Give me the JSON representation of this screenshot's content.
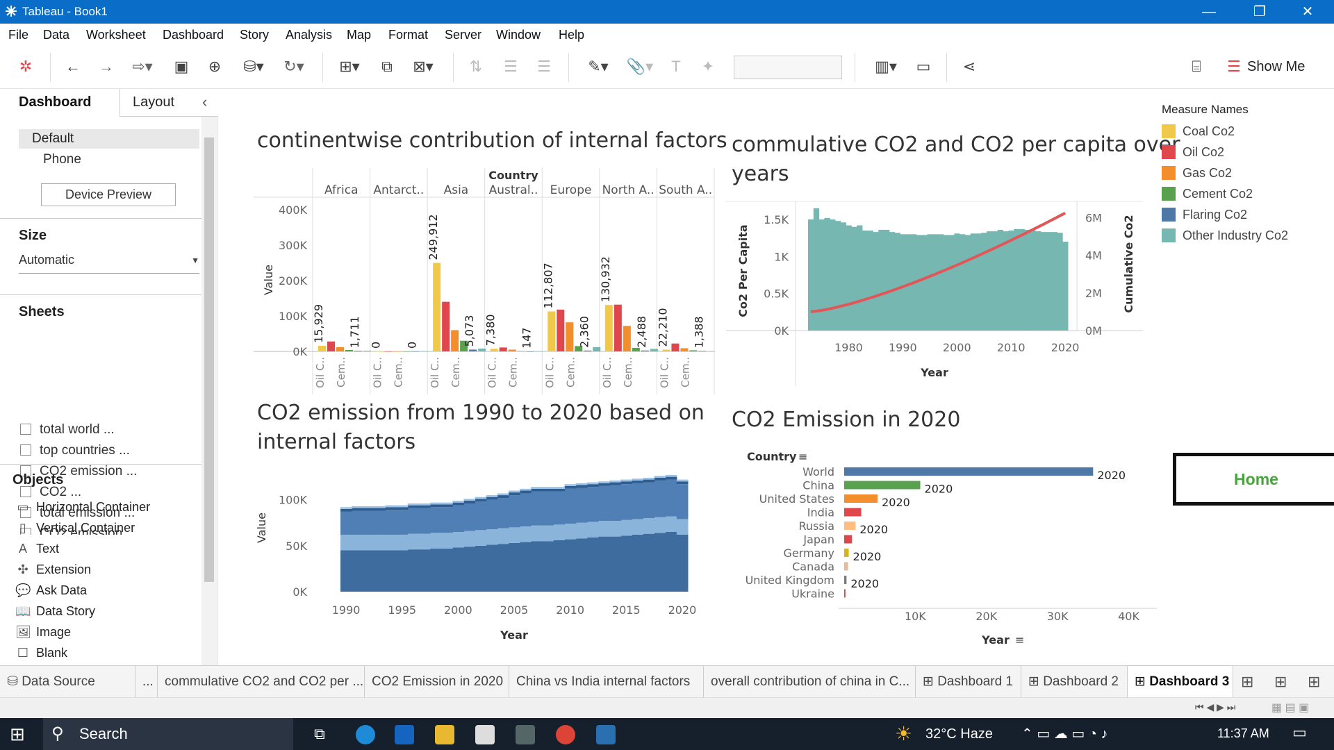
{
  "window": {
    "title": "Tableau - Book1",
    "controls": [
      "—",
      "❐",
      "✕"
    ]
  },
  "menu": [
    "File",
    "Data",
    "Worksheet",
    "Dashboard",
    "Story",
    "Analysis",
    "Map",
    "Format",
    "Server",
    "Window",
    "Help"
  ],
  "toolbar": {
    "show_me": "Show Me"
  },
  "leftpane": {
    "tabs": {
      "dashboard": "Dashboard",
      "layout": "Layout"
    },
    "devices": [
      "Default",
      "Phone"
    ],
    "device_preview": "Device Preview",
    "size_title": "Size",
    "size_value": "Automatic",
    "sheets_title": "Sheets",
    "sheets": [
      "total world ...",
      "top countries ...",
      "CO2 emission ...",
      "CO2 ...",
      "total emission ...",
      "CO2 emission"
    ],
    "objects_title": "Objects",
    "objects": [
      {
        "icon": "horizontal-container-icon",
        "glyph": "▭",
        "label": "Horizontal Container"
      },
      {
        "icon": "vertical-container-icon",
        "glyph": "▯",
        "label": "Vertical Container"
      },
      {
        "icon": "text-icon",
        "glyph": "A",
        "label": "Text"
      },
      {
        "icon": "extension-icon",
        "glyph": "✣",
        "label": "Extension"
      },
      {
        "icon": "ask-data-icon",
        "glyph": "💬",
        "label": "Ask Data"
      },
      {
        "icon": "data-story-icon",
        "glyph": "📖",
        "label": "Data Story"
      },
      {
        "icon": "image-icon",
        "glyph": "🖼",
        "label": "Image"
      },
      {
        "icon": "blank-icon",
        "glyph": "☐",
        "label": "Blank"
      }
    ]
  },
  "titles": {
    "chart1": "continentwise contribution of internal factors",
    "chart2a": "commulative CO2 and CO2 per capita over",
    "chart2b": "years",
    "chart3a": "CO2 emission from 1990 to 2020 based on",
    "chart3b": "internal factors",
    "chart4": "CO2 Emission in 2020"
  },
  "legend": {
    "title": "Measure Names",
    "items": [
      {
        "label": "Coal Co2",
        "color": "#f1c94a"
      },
      {
        "label": "Oil Co2",
        "color": "#e0474c"
      },
      {
        "label": "Gas Co2",
        "color": "#f28e2b"
      },
      {
        "label": "Cement Co2",
        "color": "#59a14f"
      },
      {
        "label": "Flaring Co2",
        "color": "#4e79a7"
      },
      {
        "label": "Other Industry Co2",
        "color": "#76b7b2"
      }
    ]
  },
  "home_label": "Home",
  "chart_data": [
    {
      "type": "bar",
      "title": "continentwise contribution of internal factors",
      "header": "Country",
      "ylabel": "Value",
      "yticks": [
        "400K",
        "300K",
        "200K",
        "100K",
        "0K"
      ],
      "ylim": [
        0,
        400000
      ],
      "continents": [
        "Africa",
        "Antarct..",
        "Asia",
        "Austral..",
        "Europe",
        "North A..",
        "South A.."
      ],
      "bottom_labels": [
        "Oil C..",
        "Cem.."
      ],
      "series_order": [
        "Coal Co2",
        "Oil Co2",
        "Gas Co2",
        "Cement Co2",
        "Flaring Co2",
        "Other Industry Co2"
      ],
      "values": [
        [
          15929,
          28000,
          12000,
          4000,
          1711,
          2000
        ],
        [
          0,
          0,
          0,
          0,
          0,
          0
        ],
        [
          249912,
          140000,
          60000,
          30000,
          5073,
          8000
        ],
        [
          7380,
          11000,
          5000,
          1000,
          147,
          300
        ],
        [
          112807,
          118000,
          82000,
          15000,
          2360,
          12000
        ],
        [
          130932,
          132000,
          72000,
          10000,
          2488,
          7000
        ],
        [
          5000,
          22210,
          9000,
          3000,
          1388,
          800
        ]
      ],
      "labels": [
        [
          "15,929",
          "1,711"
        ],
        [
          "0",
          "0"
        ],
        [
          "249,912",
          "5,073"
        ],
        [
          "7,380",
          "147"
        ],
        [
          "112,807",
          "2,360"
        ],
        [
          "130,932",
          "2,488"
        ],
        [
          "22,210",
          "1,388"
        ]
      ]
    },
    {
      "type": "area",
      "title": "commulative CO2 and CO2 per capita over years",
      "xlabel": "Year",
      "ylabel_left": "Co2 Per Capita",
      "ylabel_right": "Cumulative Co2",
      "xticks": [
        "1980",
        "1990",
        "2000",
        "2010",
        "2020"
      ],
      "yticks_left": [
        "1.5K",
        "1K",
        "0.5K",
        "0K"
      ],
      "yticks_right": [
        "6M",
        "4M",
        "2M",
        "0M"
      ],
      "years": [
        1973,
        1974,
        1975,
        1976,
        1977,
        1978,
        1979,
        1980,
        1981,
        1982,
        1983,
        1984,
        1985,
        1986,
        1987,
        1988,
        1989,
        1990,
        1991,
        1992,
        1993,
        1994,
        1995,
        1996,
        1997,
        1998,
        1999,
        2000,
        2001,
        2002,
        2003,
        2004,
        2005,
        2006,
        2007,
        2008,
        2009,
        2010,
        2011,
        2012,
        2013,
        2014,
        2015,
        2016,
        2017,
        2018,
        2019,
        2020
      ],
      "per_capita": [
        1500,
        1650,
        1500,
        1520,
        1500,
        1480,
        1460,
        1420,
        1400,
        1420,
        1350,
        1350,
        1330,
        1360,
        1360,
        1330,
        1320,
        1300,
        1300,
        1300,
        1290,
        1290,
        1300,
        1300,
        1300,
        1290,
        1290,
        1310,
        1300,
        1290,
        1310,
        1310,
        1320,
        1340,
        1340,
        1360,
        1340,
        1350,
        1370,
        1370,
        1360,
        1350,
        1340,
        1330,
        1330,
        1330,
        1320,
        1200
      ],
      "cumulative": [
        1000000,
        6250000
      ]
    },
    {
      "type": "area",
      "title": "CO2 emission from 1990 to 2020 based on internal factors",
      "xlabel": "Year",
      "ylabel": "Value",
      "xticks": [
        "1990",
        "1995",
        "2000",
        "2005",
        "2010",
        "2015",
        "2020"
      ],
      "yticks": [
        "100K",
        "50K",
        "0K"
      ],
      "ylim": [
        0,
        130000
      ],
      "years": [
        1990,
        1991,
        1992,
        1993,
        1994,
        1995,
        1996,
        1997,
        1998,
        1999,
        2000,
        2001,
        2002,
        2003,
        2004,
        2005,
        2006,
        2007,
        2008,
        2009,
        2010,
        2011,
        2012,
        2013,
        2014,
        2015,
        2016,
        2017,
        2018,
        2019,
        2020
      ],
      "layers": [
        {
          "name": "base",
          "color": "#3e6c9e",
          "values": [
            45000,
            45000,
            45000,
            45000,
            45000,
            45000,
            46000,
            46000,
            47000,
            47000,
            48000,
            49000,
            50000,
            51000,
            52000,
            53000,
            54000,
            55000,
            55000,
            56000,
            57000,
            58000,
            59000,
            60000,
            60000,
            61000,
            62000,
            63000,
            64000,
            65000,
            62000
          ]
        },
        {
          "name": "mid",
          "color": "#8ab4da",
          "values": [
            17000,
            17000,
            17000,
            17000,
            17000,
            17000,
            17000,
            17000,
            17000,
            17000,
            17000,
            17000,
            17000,
            17000,
            17000,
            17000,
            17000,
            17000,
            17000,
            17000,
            17000,
            17000,
            17000,
            17000,
            17000,
            17000,
            17000,
            17000,
            17000,
            17000,
            17000
          ]
        },
        {
          "name": "upper",
          "color": "#4f7fb5",
          "values": [
            25000,
            26000,
            26000,
            26000,
            27000,
            27000,
            28000,
            28000,
            28000,
            28000,
            29000,
            30000,
            31000,
            32000,
            33000,
            35000,
            36000,
            37000,
            37000,
            36000,
            38000,
            38000,
            38000,
            38000,
            39000,
            39000,
            39000,
            39000,
            40000,
            40000,
            38000
          ]
        },
        {
          "name": "top",
          "color": "#2f5d8f",
          "values": [
            3000,
            3000,
            3000,
            3000,
            3000,
            3000,
            3000,
            3000,
            3000,
            3000,
            3000,
            3000,
            3000,
            3000,
            3000,
            3000,
            3000,
            3000,
            3000,
            3000,
            3000,
            3000,
            3000,
            3000,
            3000,
            3000,
            3000,
            3000,
            3000,
            3000,
            3000
          ]
        },
        {
          "name": "cap",
          "color": "#9bc2e6",
          "values": [
            2000,
            2000,
            2000,
            2000,
            2000,
            2000,
            2000,
            2000,
            2000,
            2000,
            2000,
            2000,
            2000,
            2000,
            2000,
            2000,
            2000,
            2000,
            2000,
            2000,
            2000,
            2000,
            2000,
            2000,
            2000,
            2000,
            2000,
            2000,
            2000,
            2000,
            2000
          ]
        }
      ]
    },
    {
      "type": "bar",
      "orientation": "horizontal",
      "title": "CO2 Emission in 2020",
      "header": "Country",
      "xlabel": "Year",
      "xticks": [
        "10K",
        "20K",
        "30K",
        "40K"
      ],
      "xlim": [
        0,
        42000
      ],
      "categories": [
        "World",
        "China",
        "United States",
        "India",
        "Russia",
        "Japan",
        "Germany",
        "Canada",
        "United Kingdom",
        "Ukraine"
      ],
      "values": [
        35000,
        10700,
        4700,
        2400,
        1600,
        1100,
        640,
        540,
        330,
        180
      ],
      "colors": [
        "#4e79a7",
        "#59a14f",
        "#f28e2b",
        "#e0474c",
        "#ffbe7d",
        "#e0474c",
        "#d7b518",
        "#e8b89a",
        "#7c7c7c",
        "#e0474c"
      ],
      "bar_labels": [
        "2020",
        "2020",
        "2020",
        "",
        "2020",
        "",
        "2020",
        "",
        "2020",
        ""
      ]
    }
  ],
  "sheettabs": [
    {
      "label": "Data Source",
      "icon": "database-icon"
    },
    {
      "label": "..."
    },
    {
      "label": "commulative CO2 and CO2 per ..."
    },
    {
      "label": "CO2 Emission in 2020"
    },
    {
      "label": "China vs India internal factors"
    },
    {
      "label": "overall contribution of china in C..."
    },
    {
      "label": "Dashboard 1"
    },
    {
      "label": "Dashboard 2"
    },
    {
      "label": "Dashboard 3"
    }
  ],
  "taskbar": {
    "search": "Search",
    "weather": "32°C  Haze",
    "time": "11:37 AM"
  }
}
